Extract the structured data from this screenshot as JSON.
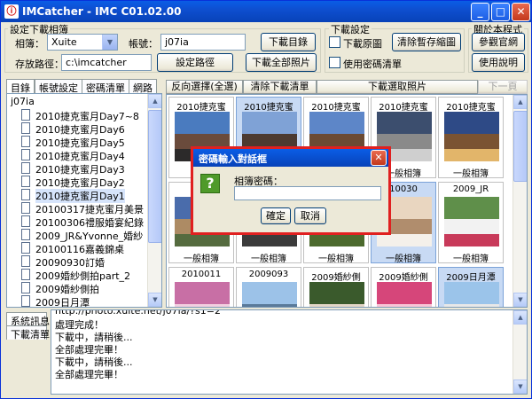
{
  "app": {
    "title": "IMCatcher - IMC C01.02.00",
    "icon": "app-logo-icon",
    "controls": {
      "minimize": "_",
      "maximize": "□",
      "close": "✕"
    }
  },
  "download_group": {
    "title": "設定下載相簿",
    "album_label": "相簿：",
    "album_value": "Xuite",
    "account_label": "帳號：",
    "account_value": "j07ia",
    "path_label": "存放路徑：",
    "path_value": "c:\\imcatcher",
    "btn_download_list": "下載目錄",
    "btn_set_path": "設定路徑",
    "btn_download_all": "下載全部照片"
  },
  "download_settings": {
    "title": "下載設定",
    "opt_original": "下載原圖",
    "opt_password": "使用密碼清單",
    "btn_clear_cache": "清除暫存縮圖"
  },
  "about": {
    "title": "關於本程式",
    "btn_official": "參觀官網",
    "btn_help": "使用說明"
  },
  "left_tabs": [
    "目錄",
    "帳號設定",
    "密碼清單",
    "網路"
  ],
  "tree": {
    "root": "j07ia",
    "items": [
      "2010捷克蜜月Day7~8",
      "2010捷克蜜月Day6",
      "2010捷克蜜月Day5",
      "2010捷克蜜月Day4",
      "2010捷克蜜月Day3",
      "2010捷克蜜月Day2",
      "2010捷克蜜月Day1",
      "20100317捷克蜜月美景",
      "20100306禮服婚宴紀錄",
      "2009_JR&Yvonne_婚紗",
      "20100116嘉義錦桌",
      "20090930訂婚",
      "2009婚紗側拍part_2",
      "2009婚紗側拍",
      "2009日月潭"
    ],
    "selected_index": 6
  },
  "photo_toolbar": {
    "btn_invert": "反向選擇(全選)",
    "btn_clear_download": "清除下載清單",
    "btn_download_selected": "下載選取照片",
    "btn_next_page": "下一頁"
  },
  "thumbs": [
    {
      "top": "2010捷克蜜",
      "bottom": "",
      "selected": false,
      "colors": [
        "#4a7bbf",
        "#6a4b3c",
        "#2c2a2a"
      ]
    },
    {
      "top": "2010捷克蜜",
      "bottom": "",
      "selected": true,
      "colors": [
        "#7fa2d6",
        "#4c3a30",
        "#8a6648"
      ]
    },
    {
      "top": "2010捷克蜜",
      "bottom": "",
      "selected": false,
      "colors": [
        "#5d86c8",
        "#6b4a33",
        "#c99b5c"
      ]
    },
    {
      "top": "2010捷克蜜",
      "bottom": "一般相簿",
      "selected": false,
      "colors": [
        "#3c4e6e",
        "#8a8a8a",
        "#cfcfcf"
      ]
    },
    {
      "top": "2010捷克蜜",
      "bottom": "一般相簿",
      "selected": false,
      "colors": [
        "#2e4a86",
        "#7a5332",
        "#e2b56a"
      ]
    },
    {
      "top": "2010",
      "bottom": "一般相簿",
      "selected": false,
      "colors": [
        "#4a6cab",
        "#ad8b64",
        "#556b3f"
      ]
    },
    {
      "top": "",
      "bottom": "一般相簿",
      "selected": false,
      "colors": [
        "#3d5a8c",
        "#c9c2b5",
        "#3b3b3b"
      ]
    },
    {
      "top": "",
      "bottom": "一般相簿",
      "selected": false,
      "colors": [
        "#5f8fbf",
        "#d9d2c1",
        "#4c6a2e"
      ]
    },
    {
      "top": "10030",
      "bottom": "一般相簿",
      "selected": true,
      "colors": [
        "#e9d6c0",
        "#b08d6d",
        "#f4f0ea"
      ]
    },
    {
      "top": "2009_JR",
      "bottom": "一般相簿",
      "selected": false,
      "colors": [
        "#5f8f4a",
        "#f2f2f2",
        "#c83a5a"
      ]
    },
    {
      "top": "2010011",
      "bottom": "",
      "selected": false,
      "colors": [
        "#c86fa5",
        "#f2d0e0",
        "#e9e9e9"
      ]
    },
    {
      "top": "2009093",
      "bottom": "",
      "selected": false,
      "colors": [
        "#9cc2e8",
        "#5a7a9a",
        "#e0e6ea"
      ]
    },
    {
      "top": "2009婚紗側",
      "bottom": "",
      "selected": false,
      "colors": [
        "#3a5a2c",
        "#e2d6c6",
        "#6a8a5a"
      ]
    },
    {
      "top": "2009婚紗側",
      "bottom": "",
      "selected": false,
      "colors": [
        "#d6467a",
        "#f8c6d6",
        "#ffffff"
      ]
    },
    {
      "top": "2009日月潭",
      "bottom": "",
      "selected": true,
      "colors": [
        "#9bc4ea",
        "#e8e8e8",
        "#5e7b97"
      ]
    }
  ],
  "bottom_tabs": [
    "系統訊息",
    "下載清單"
  ],
  "log": {
    "lines": [
      "http://photo.xuite.net/j07ia/?s1=2",
      "處理完成！",
      "下載中，請稍後...",
      "全部處理完畢！",
      "下載中，請稍後...",
      "全部處理完畢！"
    ]
  },
  "password_dialog": {
    "title": "密碼輸入對話框",
    "icon": "question-icon",
    "prompt": "相簿密碼：",
    "value": "",
    "btn_ok": "確定",
    "btn_cancel": "取消",
    "border_color": "#e02020"
  }
}
